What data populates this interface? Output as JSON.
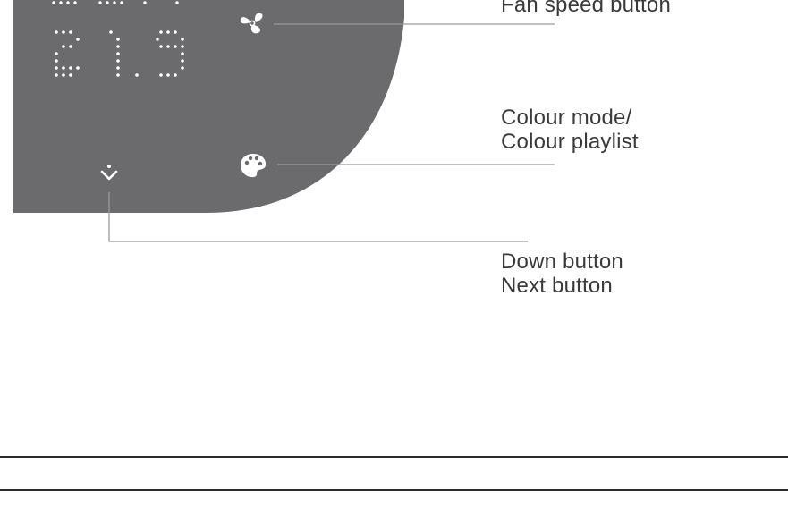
{
  "colors": {
    "panel": "#6b6b6e",
    "dot": "#ffffff",
    "leader_line": "#9a9a9a",
    "label_text": "#3a3a3a",
    "divider": "#2b2b2b"
  },
  "display": {
    "bottom_reading": "21.9"
  },
  "icons": {
    "fan": "fan-icon",
    "palette": "palette-icon",
    "down": "chevron-down-icon"
  },
  "callouts": {
    "fan_speed": {
      "line1": "Fan speed button"
    },
    "colour": {
      "line1": "Colour mode/",
      "line2": "Colour playlist"
    },
    "down": {
      "line1": "Down button",
      "line2": "Next button"
    }
  }
}
